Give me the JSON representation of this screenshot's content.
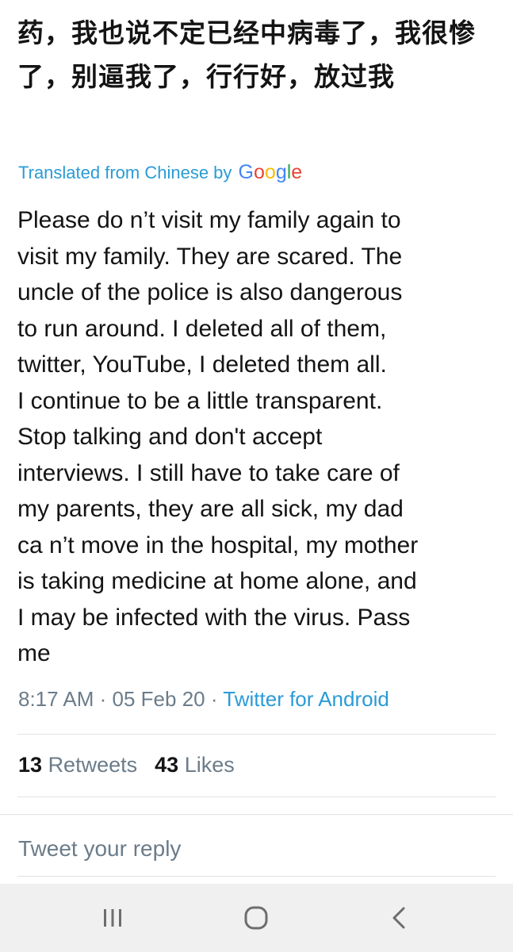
{
  "tweet": {
    "original_text": "药，我也说不定已经中病毒了，我很惨了，别逼我了，行行好，放过我",
    "translated_label": "Translated from Chinese by",
    "translator_logo": {
      "letters": [
        "G",
        "o",
        "o",
        "g",
        "l",
        "e"
      ],
      "colors": [
        "#4285f4",
        "#ea4335",
        "#fbbc05",
        "#4285f4",
        "#34a853",
        "#ea4335"
      ]
    },
    "translation": "Please do n’t visit my family again to\nvisit my family. They are scared. The\nuncle of the police is also dangerous\nto run around. I deleted all of them,\ntwitter, YouTube, I deleted them all.\nI continue to be a little transparent.\nStop talking and don't accept\ninterviews. I still have to take care of\nmy parents, they are all sick, my dad\nca n’t move in the hospital, my mother\nis taking medicine at home alone, and\nI may be infected with the virus. Pass\nme",
    "time": "8:17 AM",
    "date": "05 Feb 20",
    "source": "Twitter for Android",
    "retweets_count": "13",
    "retweets_label": "Retweets",
    "likes_count": "43",
    "likes_label": "Likes"
  },
  "reply": {
    "placeholder": "Tweet your reply"
  },
  "navbar": {
    "icons": [
      "recent-apps-icon",
      "home-icon",
      "back-icon"
    ]
  },
  "colors": {
    "link": "#2a9bd6",
    "secondary_text": "#6b7c8a",
    "primary_text": "#141414",
    "navbar_bg": "#f0f0f0"
  }
}
